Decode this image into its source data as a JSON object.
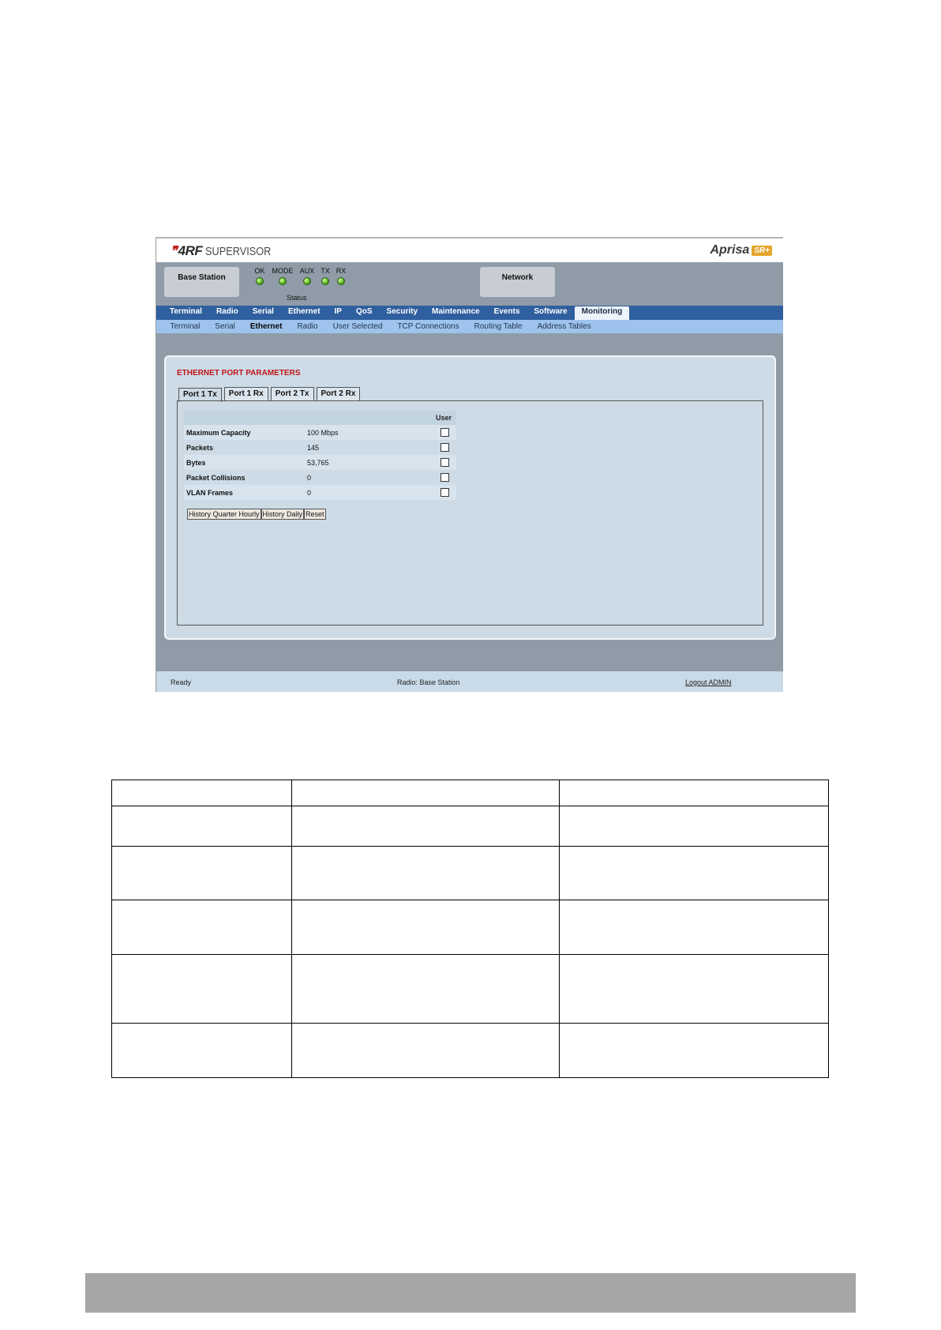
{
  "app": {
    "logo_mark": "❞",
    "logo_text": "4RF",
    "logo_suffix": "SUPERVISOR",
    "brand_name": "Aprisa",
    "brand_badge": "SR+"
  },
  "status": {
    "station_label": "Base Station",
    "network_label": "Network",
    "caption": "Status",
    "leds": [
      "OK",
      "MODE",
      "AUX",
      "TX",
      "RX"
    ],
    "led_color": "#4fb01c"
  },
  "nav_main": {
    "items": [
      "Terminal",
      "Radio",
      "Serial",
      "Ethernet",
      "IP",
      "QoS",
      "Security",
      "Maintenance",
      "Events",
      "Software",
      "Monitoring"
    ],
    "active": "Monitoring"
  },
  "nav_sub": {
    "items": [
      "Terminal",
      "Serial",
      "Ethernet",
      "Radio",
      "User Selected",
      "TCP Connections",
      "Routing Table",
      "Address Tables"
    ],
    "active": "Ethernet"
  },
  "panel": {
    "title": "ETHERNET PORT PARAMETERS",
    "title_color": "#c0151a",
    "tabs": [
      "Port 1 Tx",
      "Port 1 Rx",
      "Port 2 Tx",
      "Port 2 Rx"
    ],
    "active_tab": "Port 1 Tx",
    "column_user": "User",
    "rows": [
      {
        "label": "Maximum Capacity",
        "value": "100 Mbps",
        "user": false
      },
      {
        "label": "Packets",
        "value": "145",
        "user": false
      },
      {
        "label": "Bytes",
        "value": "53,765",
        "user": false
      },
      {
        "label": "Packet Collisions",
        "value": "0",
        "user": false
      },
      {
        "label": "VLAN Frames",
        "value": "0",
        "user": false
      }
    ],
    "buttons": [
      "History Quarter Hourly",
      "History Daily",
      "Reset"
    ]
  },
  "footer": {
    "status": "Ready",
    "radio": "Radio: Base Station",
    "logout": "Logout ADMIN"
  },
  "doc_table": {
    "rows": [
      [
        "",
        "",
        ""
      ],
      [
        "",
        "",
        ""
      ],
      [
        "",
        "",
        ""
      ],
      [
        "",
        "",
        ""
      ],
      [
        "",
        "",
        ""
      ],
      [
        "",
        "",
        ""
      ]
    ]
  }
}
